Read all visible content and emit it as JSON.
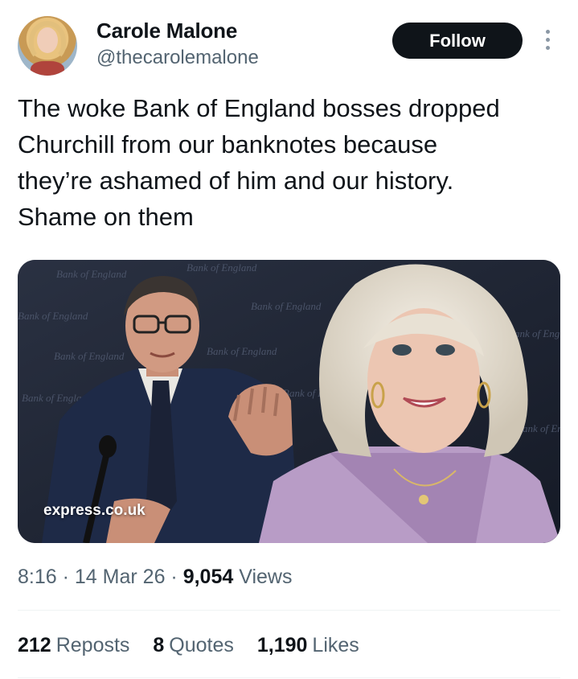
{
  "author": {
    "name": "Carole Malone",
    "handle": "@thecarolemalone"
  },
  "follow_label": "Follow",
  "tweet": {
    "text": "The woke Bank of England bosses dropped\nChurchill from our banknotes because\nthey’re ashamed of him and our history.\nShame on them"
  },
  "media": {
    "watermark": "express.co.uk",
    "backdrop_text": "Bank of England"
  },
  "meta": {
    "time": "8:16",
    "date": "14 Mar 26",
    "views_count": "9,054",
    "views_label": "Views"
  },
  "stats": {
    "reposts_count": "212",
    "reposts_label": "Reposts",
    "quotes_count": "8",
    "quotes_label": "Quotes",
    "likes_count": "1,190",
    "likes_label": "Likes"
  },
  "colors": {
    "text_primary": "#0f1419",
    "text_secondary": "#536471",
    "follow_bg": "#0f1419",
    "follow_text": "#ffffff",
    "divider": "#eff3f4"
  },
  "icons": {
    "more": "more-vertical-icon"
  }
}
